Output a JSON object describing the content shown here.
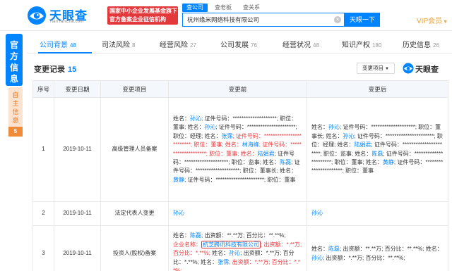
{
  "header": {
    "logo_name": "天眼查",
    "logo_domain": "TianYanCha.com",
    "gov_badge_line1": "国家中小企业发展基金旗下",
    "gov_badge_line2": "官方备案企业征信机构",
    "search_tabs": [
      "查公司",
      "查老板",
      "查关系"
    ],
    "search_value": "杭州缘米网络科技有限公司",
    "search_button": "天眼一下",
    "vip_label": "VIP会员"
  },
  "side": {
    "official_label": "官方信息",
    "self_label": "自主信息",
    "self_count": "5"
  },
  "tabs": [
    {
      "label": "公司背景",
      "count": "48"
    },
    {
      "label": "司法风险",
      "count": "8"
    },
    {
      "label": "经营风险",
      "count": "27"
    },
    {
      "label": "公司发展",
      "count": "76"
    },
    {
      "label": "经营状况",
      "count": "48"
    },
    {
      "label": "知识产权",
      "count": "180"
    },
    {
      "label": "历史信息",
      "count": "26"
    }
  ],
  "section": {
    "title": "变更记录",
    "count": "15",
    "filter_label": "变更项目",
    "watermark": "天眼查"
  },
  "table": {
    "headers": [
      "序号",
      "变更日期",
      "变更项目",
      "变更前",
      "变更后"
    ],
    "rows": [
      {
        "no": "1",
        "date": "2019-10-11",
        "item": "高级管理人员备案"
      },
      {
        "no": "2",
        "date": "2019-10-11",
        "item": "法定代表人变更",
        "before": "孙沁",
        "after": "孙沁"
      },
      {
        "no": "3",
        "date": "2019-10-11",
        "item": "投资人(股权)备案"
      }
    ],
    "r1_before": {
      "a1": "姓名：",
      "n1": "孙沁",
      "a2": "; 证件号码：********************; 职位：董事; 姓名：",
      "n2": "孙沁",
      "a3": "; 证件号码：**********************; 职位：经理; 姓名：",
      "n3": "张霈",
      "r1": "; 证件号码：*************************",
      "r2": "; 职位：董事; 姓名：",
      "n4": "林海峰",
      "r3": "; 证件号码：********************",
      "r4": "; 职位：董事; 姓名：",
      "n5": "陆娟君",
      "a4": "; 证件号码：********************; 职位：监事; 姓名：",
      "n6": "陈磊",
      "a5": "; 证件号码：********************; 职位：董事长; 姓名：",
      "n7": "黄静",
      "a6": "; 证件号码：**********************; 职位：董事"
    },
    "r1_after": {
      "a1": "姓名：",
      "n1": "孙沁",
      "a2": "; 证件号码：********************; 职位：董事长; 姓名：",
      "n2": "孙沁",
      "a3": "; 证件号码：**********************; 职位：经理; 姓名：",
      "n3": "陆娟君",
      "a4": "; 证件号码：**********************; 职位：监事; 姓名：",
      "n4": "陈磊",
      "a5": "; 证件号码：**********************; 职位：董事; 姓名：",
      "n5": "黄静",
      "a6": "; 证件号码：**********************; 职位：董事"
    },
    "r3_before": {
      "a1": "姓名：",
      "n1": "陈磊",
      "a2": "; 出资额：**.**万; 百分比：**.**%;",
      "r1": "企业名称：",
      "company": "杭芝腾讯科技有限公司",
      "r2": "; 出资额：*.**万; 百分比：*.**%;",
      "a3": " 姓名：",
      "n2": "孙沁",
      "a4": "; 出资额：*.**万; 百分比：*.**%; 姓名：",
      "n3": "张霈",
      "r3": "; 出资额：*.**万; 百分比：*.**%;"
    },
    "r3_after": {
      "a1": "姓名：",
      "n1": "陈磊",
      "a2": "; 出资额：**.**万; 百分比：**.**%; 姓名：",
      "n2": "孙沁",
      "a3": "; 出资额：*.**万; 百分比：**.**%;"
    }
  },
  "colors": {
    "brand_blue": "#0084ff",
    "alert_red": "#e4393c",
    "vip_gold": "#e8a23a",
    "self_orange": "#f08b3a"
  }
}
